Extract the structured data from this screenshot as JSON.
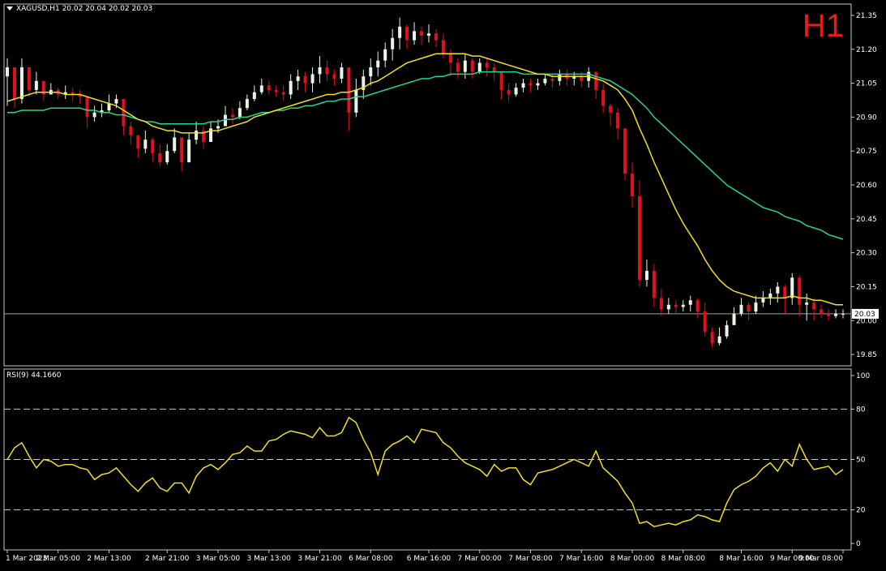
{
  "header": {
    "symbol_line": "XAGUSD,H1  20.02 20.04 20.02 20.03",
    "timeframe": "H1"
  },
  "indicator": {
    "label": "RSI(9) 44.1660"
  },
  "colors": {
    "bull": "#e8f5e4",
    "bear": "#e01020",
    "ma_fast": "#f0e020",
    "ma_slow": "#20d890",
    "rsi": "#f0e020",
    "grid": "#ffffff"
  },
  "chart_data": [
    {
      "type": "candlestick",
      "name": "price",
      "price_axis_ticks": [
        "21.35",
        "21.20",
        "21.05",
        "20.90",
        "20.75",
        "20.60",
        "20.45",
        "20.30",
        "20.15",
        "20.00",
        "19.85"
      ],
      "ylim": [
        19.8,
        21.4
      ],
      "current_price": "20.03",
      "time_axis_ticks": [
        "1 Mar 2023",
        "2 Mar 05:00",
        "2 Mar 13:00",
        "2 Mar 21:00",
        "3 Mar 05:00",
        "3 Mar 13:00",
        "3 Mar 21:00",
        "6 Mar 08:00",
        "6 Mar 16:00",
        "7 Mar 00:00",
        "7 Mar 08:00",
        "7 Mar 16:00",
        "8 Mar 00:00",
        "8 Mar 08:00",
        "8 Mar 16:00",
        "9 Mar 00:00",
        "9 Mar 08:00"
      ],
      "closes": [
        21.12,
        20.98,
        21.12,
        21.02,
        21.06,
        21.0,
        21.02,
        21.0,
        21.01,
        21.0,
        20.99,
        20.9,
        20.92,
        20.93,
        20.96,
        20.98,
        20.86,
        20.82,
        20.76,
        20.8,
        20.74,
        20.7,
        20.75,
        20.81,
        20.7,
        20.8,
        20.84,
        20.79,
        20.85,
        20.86,
        20.91,
        20.9,
        20.94,
        20.98,
        21.01,
        21.04,
        21.02,
        21.01,
        21.0,
        21.06,
        21.08,
        21.05,
        21.09,
        21.12,
        21.09,
        21.07,
        21.12,
        20.92,
        21.02,
        21.08,
        21.12,
        21.15,
        21.2,
        21.25,
        21.3,
        21.24,
        21.28,
        21.26,
        21.27,
        21.24,
        21.18,
        21.14,
        21.1,
        21.15,
        21.1,
        21.14,
        21.12,
        21.1,
        21.02,
        21.0,
        21.03,
        21.05,
        21.04,
        21.05,
        21.07,
        21.06,
        21.09,
        21.07,
        21.08,
        21.06,
        21.1,
        21.02,
        20.95,
        20.92,
        20.85,
        20.65,
        20.55,
        20.18,
        20.22,
        20.1,
        20.05,
        20.07,
        20.06,
        20.07,
        20.09,
        20.04,
        19.95,
        19.9,
        19.93,
        19.98,
        20.03,
        20.07,
        20.04,
        20.08,
        20.1,
        20.12,
        20.15,
        20.1,
        20.19,
        20.07,
        20.08,
        20.05,
        20.03,
        20.02,
        20.03,
        20.03
      ],
      "highs": [
        21.16,
        21.06,
        21.16,
        21.1,
        21.1,
        21.04,
        21.05,
        21.03,
        21.04,
        21.03,
        21.02,
        20.98,
        20.95,
        20.96,
        21.0,
        21.0,
        20.97,
        20.88,
        20.82,
        20.84,
        20.81,
        20.78,
        20.78,
        20.85,
        20.8,
        20.83,
        20.88,
        20.86,
        20.88,
        20.89,
        20.95,
        20.94,
        20.97,
        21.0,
        21.04,
        21.07,
        21.06,
        21.04,
        21.04,
        21.09,
        21.11,
        21.1,
        21.12,
        21.17,
        21.15,
        21.11,
        21.14,
        21.08,
        21.07,
        21.11,
        21.16,
        21.19,
        21.23,
        21.29,
        21.34,
        21.31,
        21.32,
        21.3,
        21.31,
        21.29,
        21.27,
        21.2,
        21.16,
        21.18,
        21.16,
        21.16,
        21.16,
        21.14,
        21.08,
        21.05,
        21.05,
        21.07,
        21.07,
        21.07,
        21.09,
        21.09,
        21.11,
        21.11,
        21.1,
        21.1,
        21.12,
        21.1,
        21.05,
        20.96,
        20.94,
        20.85,
        20.7,
        20.62,
        20.27,
        20.25,
        20.14,
        20.1,
        20.09,
        20.09,
        20.11,
        20.1,
        20.08,
        19.97,
        19.97,
        20.0,
        20.06,
        20.1,
        20.08,
        20.11,
        20.13,
        20.14,
        20.17,
        20.16,
        20.21,
        20.2,
        20.12,
        20.1,
        20.07,
        20.05,
        20.05,
        20.05
      ],
      "lows": [
        20.95,
        20.94,
        20.96,
        20.99,
        21.0,
        20.97,
        21.0,
        20.98,
        20.98,
        20.97,
        20.96,
        20.85,
        20.88,
        20.9,
        20.92,
        20.94,
        20.82,
        20.78,
        20.72,
        20.74,
        20.7,
        20.68,
        20.69,
        20.74,
        20.66,
        20.72,
        20.78,
        20.76,
        20.8,
        20.83,
        20.86,
        20.87,
        20.89,
        20.93,
        20.97,
        21.0,
        21.0,
        20.99,
        20.97,
        20.98,
        21.02,
        21.01,
        21.01,
        21.05,
        21.06,
        21.04,
        21.05,
        20.84,
        20.9,
        20.98,
        21.04,
        21.08,
        21.12,
        21.15,
        21.2,
        21.2,
        21.22,
        21.22,
        21.23,
        21.21,
        21.16,
        21.08,
        21.07,
        21.07,
        21.07,
        21.09,
        21.08,
        21.06,
        20.98,
        20.97,
        20.99,
        21.01,
        21.01,
        21.02,
        21.04,
        21.03,
        21.04,
        21.04,
        21.04,
        21.03,
        21.03,
        20.98,
        20.92,
        20.86,
        20.8,
        20.62,
        20.5,
        20.15,
        20.15,
        20.06,
        20.02,
        20.03,
        20.03,
        20.04,
        20.04,
        20.01,
        19.93,
        19.88,
        19.89,
        19.92,
        19.98,
        20.02,
        20.0,
        20.03,
        20.06,
        20.07,
        20.08,
        20.03,
        20.07,
        20.02,
        20.0,
        20.0,
        20.01,
        20.0,
        20.01,
        20.01
      ],
      "ma_fast": [
        20.97,
        20.98,
        20.99,
        21.0,
        21.01,
        21.01,
        21.01,
        21.01,
        21.0,
        21.0,
        21.0,
        20.99,
        20.98,
        20.97,
        20.96,
        20.95,
        20.93,
        20.91,
        20.89,
        20.88,
        20.86,
        20.85,
        20.84,
        20.84,
        20.83,
        20.83,
        20.83,
        20.83,
        20.84,
        20.84,
        20.85,
        20.86,
        20.87,
        20.88,
        20.9,
        20.91,
        20.92,
        20.93,
        20.94,
        20.95,
        20.96,
        20.97,
        20.98,
        20.99,
        21.0,
        21.0,
        21.01,
        21.01,
        21.02,
        21.03,
        21.05,
        21.06,
        21.08,
        21.1,
        21.12,
        21.14,
        21.15,
        21.16,
        21.17,
        21.18,
        21.18,
        21.18,
        21.18,
        21.18,
        21.17,
        21.17,
        21.16,
        21.15,
        21.14,
        21.13,
        21.12,
        21.11,
        21.1,
        21.09,
        21.09,
        21.08,
        21.08,
        21.08,
        21.08,
        21.08,
        21.08,
        21.07,
        21.06,
        21.04,
        21.02,
        20.98,
        20.93,
        20.85,
        20.78,
        20.7,
        20.63,
        20.56,
        20.49,
        20.43,
        20.38,
        20.33,
        20.27,
        20.22,
        20.18,
        20.15,
        20.13,
        20.12,
        20.11,
        20.1,
        20.1,
        20.1,
        20.1,
        20.1,
        20.11,
        20.1,
        20.1,
        20.09,
        20.09,
        20.08,
        20.07,
        20.07
      ],
      "ma_slow": [
        20.92,
        20.92,
        20.93,
        20.93,
        20.93,
        20.93,
        20.94,
        20.94,
        20.94,
        20.94,
        20.94,
        20.93,
        20.93,
        20.92,
        20.92,
        20.91,
        20.91,
        20.9,
        20.89,
        20.88,
        20.88,
        20.87,
        20.87,
        20.87,
        20.87,
        20.87,
        20.87,
        20.87,
        20.88,
        20.88,
        20.89,
        20.89,
        20.9,
        20.9,
        20.91,
        20.92,
        20.92,
        20.93,
        20.93,
        20.94,
        20.94,
        20.95,
        20.95,
        20.96,
        20.97,
        20.97,
        20.98,
        20.98,
        20.99,
        20.99,
        21.0,
        21.01,
        21.02,
        21.03,
        21.04,
        21.05,
        21.06,
        21.07,
        21.07,
        21.08,
        21.08,
        21.09,
        21.09,
        21.09,
        21.09,
        21.1,
        21.1,
        21.1,
        21.1,
        21.1,
        21.1,
        21.09,
        21.09,
        21.09,
        21.09,
        21.09,
        21.09,
        21.09,
        21.09,
        21.09,
        21.09,
        21.08,
        21.07,
        21.06,
        21.04,
        21.02,
        21.0,
        20.97,
        20.94,
        20.9,
        20.87,
        20.84,
        20.81,
        20.78,
        20.75,
        20.72,
        20.69,
        20.66,
        20.63,
        20.6,
        20.58,
        20.56,
        20.54,
        20.52,
        20.5,
        20.49,
        20.48,
        20.46,
        20.45,
        20.44,
        20.42,
        20.41,
        20.4,
        20.38,
        20.37,
        20.36
      ]
    },
    {
      "type": "line",
      "name": "RSI(9)",
      "axis_ticks": [
        "100",
        "80",
        "50",
        "20",
        "0"
      ],
      "levels": [
        80,
        50,
        20
      ],
      "ylim": [
        0,
        100
      ],
      "values": [
        50,
        57,
        60,
        52,
        45,
        50,
        49,
        46,
        47,
        47,
        45,
        44,
        38,
        41,
        42,
        45,
        40,
        35,
        31,
        36,
        39,
        33,
        31,
        36,
        36,
        30,
        40,
        45,
        47,
        44,
        48,
        53,
        54,
        58,
        55,
        55,
        61,
        62,
        65,
        67,
        66,
        65,
        63,
        69,
        64,
        64,
        66,
        75,
        72,
        62,
        54,
        41,
        55,
        59,
        61,
        64,
        60,
        68,
        67,
        66,
        60,
        57,
        52,
        48,
        46,
        44,
        40,
        47,
        43,
        45,
        45,
        38,
        35,
        42,
        43,
        44,
        46,
        48,
        50,
        48,
        46,
        55,
        45,
        41,
        37,
        30,
        24,
        12,
        13,
        10,
        11,
        12,
        11,
        13,
        14,
        17,
        16,
        14,
        13,
        24,
        32,
        35,
        37,
        40,
        45,
        48,
        43,
        50,
        46,
        59,
        50,
        44,
        45,
        46,
        41,
        44
      ]
    }
  ]
}
